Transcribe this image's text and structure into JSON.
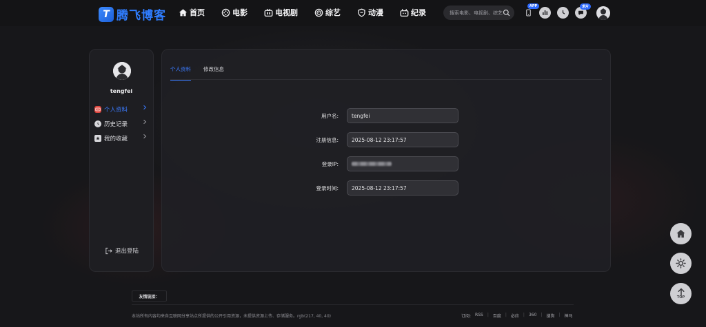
{
  "header": {
    "logo_mark": "T",
    "logo_text": "腾飞博客",
    "nav": [
      {
        "label": "首页",
        "icon": "home-icon"
      },
      {
        "label": "电影",
        "icon": "film-reel-icon"
      },
      {
        "label": "电视剧",
        "icon": "tv-icon"
      },
      {
        "label": "综艺",
        "icon": "target-icon"
      },
      {
        "label": "动漫",
        "icon": "shield-icon"
      },
      {
        "label": "纪录",
        "icon": "tv-antenna-icon"
      }
    ],
    "search_placeholder": "搜索电影、电视剧、综艺",
    "app_badge": "APP",
    "chat_badge": "求片"
  },
  "sidebar": {
    "username": "tengfei",
    "items": [
      {
        "label": "个人资料",
        "icon": "profile-card-icon",
        "active": true
      },
      {
        "label": "历史记录",
        "icon": "history-icon",
        "active": false
      },
      {
        "label": "我的收藏",
        "icon": "favorite-icon",
        "active": false
      }
    ],
    "logout_label": "退出登陆"
  },
  "main": {
    "tabs": [
      {
        "label": "个人资料",
        "active": true
      },
      {
        "label": "修改信息",
        "active": false
      }
    ],
    "fields": [
      {
        "label": "用户名:",
        "value": "tengfei"
      },
      {
        "label": "注册信息:",
        "value": "2025-08-12 23:17:57"
      },
      {
        "label": "登录IP:",
        "value": ""
      },
      {
        "label": "登录时间:",
        "value": "2025-08-12 23:17:57"
      }
    ]
  },
  "footer": {
    "links_label": "友情链接：",
    "disclaimer": "本站所有内容均来自互联网分享站点所提供的公开引用资源，未提供资源上传、存储服务。rgb(217, 40, 40)",
    "subscribe_label": "订阅:",
    "links": [
      "RSS",
      "百度",
      "必应",
      "360",
      "搜狗",
      "神马"
    ]
  },
  "float": {
    "top_label": "TOP"
  },
  "colors": {
    "accent": "#3b7bff",
    "brand": "#2f7dff",
    "background": "#17171a"
  }
}
